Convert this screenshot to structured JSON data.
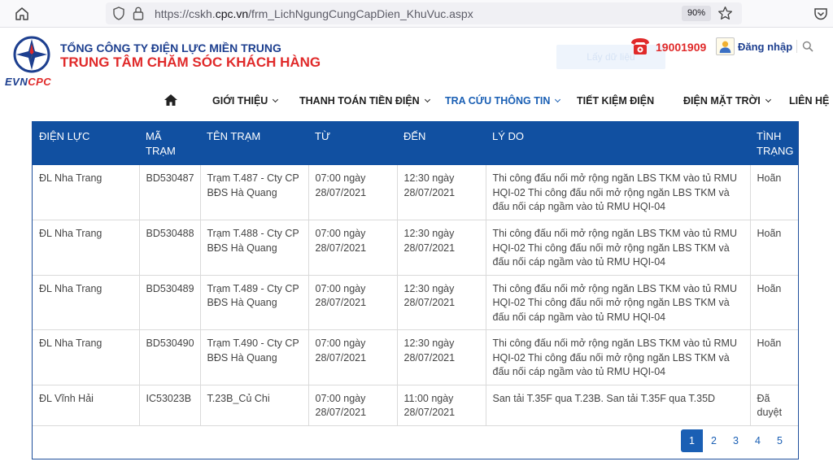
{
  "browser": {
    "url_prefix": "https://cskh.",
    "url_domain": "cpc.vn",
    "url_path": "/frm_LichNgungCungCapDien_KhuVuc.aspx",
    "zoom": "90%"
  },
  "header": {
    "logo_evn": "EVN",
    "logo_cpc": "CPC",
    "company_line1": "TỔNG CÔNG TY ĐIỆN LỰC MIỀN TRUNG",
    "company_line2": "TRUNG TÂM CHĂM SÓC KHÁCH HÀNG",
    "hotline": "19001909",
    "login": "Đăng nhập",
    "ghost_button": "Lấy dữ liệu"
  },
  "nav": {
    "items": [
      {
        "label": "GIỚI THIỆU"
      },
      {
        "label": "THANH TOÁN TIỀN ĐIỆN"
      },
      {
        "label": "TRA CỨU THÔNG TIN"
      },
      {
        "label": "TIẾT KIỆM ĐIỆN"
      },
      {
        "label": "ĐIỆN MẶT TRỜI"
      },
      {
        "label": "LIÊN HỆ"
      }
    ]
  },
  "table": {
    "headers": [
      "ĐIỆN LỰC",
      "MÃ TRẠM",
      "TÊN TRẠM",
      "TỪ",
      "ĐẾN",
      "LÝ DO",
      "TÌNH TRẠNG"
    ],
    "rows": [
      {
        "dien_luc": "ĐL Nha Trang",
        "ma_tram": "BD530487",
        "ten_tram": "Trạm T.487 - Cty CP BĐS Hà Quang",
        "tu": "07:00 ngày 28/07/2021",
        "den": "12:30 ngày 28/07/2021",
        "ly_do": "Thi công đấu nối mở rộng ngăn LBS TKM vào tủ RMU HQI-02 Thi công đấu nối mở rộng ngăn LBS TKM và đấu nối cáp ngầm vào tủ RMU HQI-04",
        "tinh_trang": "Hoãn"
      },
      {
        "dien_luc": "ĐL Nha Trang",
        "ma_tram": "BD530488",
        "ten_tram": "Trạm T.488 - Cty CP BĐS Hà Quang",
        "tu": "07:00 ngày 28/07/2021",
        "den": "12:30 ngày 28/07/2021",
        "ly_do": "Thi công đấu nối mở rộng ngăn LBS TKM vào tủ RMU HQI-02 Thi công đấu nối mở rộng ngăn LBS TKM và đấu nối cáp ngầm vào tủ RMU HQI-04",
        "tinh_trang": "Hoãn"
      },
      {
        "dien_luc": "ĐL Nha Trang",
        "ma_tram": "BD530489",
        "ten_tram": "Trạm T.489 - Cty CP BĐS Hà Quang",
        "tu": "07:00 ngày 28/07/2021",
        "den": "12:30 ngày 28/07/2021",
        "ly_do": "Thi công đấu nối mở rộng ngăn LBS TKM vào tủ RMU HQI-02 Thi công đấu nối mở rộng ngăn LBS TKM và đấu nối cáp ngầm vào tủ RMU HQI-04",
        "tinh_trang": "Hoãn"
      },
      {
        "dien_luc": "ĐL Nha Trang",
        "ma_tram": "BD530490",
        "ten_tram": "Trạm T.490 - Cty CP BĐS Hà Quang",
        "tu": "07:00 ngày 28/07/2021",
        "den": "12:30 ngày 28/07/2021",
        "ly_do": "Thi công đấu nối mở rộng ngăn LBS TKM vào tủ RMU HQI-02 Thi công đấu nối mở rộng ngăn LBS TKM và đấu nối cáp ngầm vào tủ RMU HQI-04",
        "tinh_trang": "Hoãn"
      },
      {
        "dien_luc": "ĐL Vĩnh Hải",
        "ma_tram": "IC53023B",
        "ten_tram": "T.23B_Củ Chi",
        "tu": "07:00 ngày 28/07/2021",
        "den": "11:00 ngày 28/07/2021",
        "ly_do": "San tải T.35F qua T.23B. San tải T.35F qua T.35D",
        "tinh_trang": "Đã duyệt"
      }
    ]
  },
  "pagination": {
    "pages": [
      "1",
      "2",
      "3",
      "4",
      "5"
    ],
    "active": "1"
  },
  "colors": {
    "brand_blue": "#1d3f8f",
    "brand_red": "#e02a2a",
    "header_row": "#1150a1",
    "accent": "#1a5fb4"
  }
}
